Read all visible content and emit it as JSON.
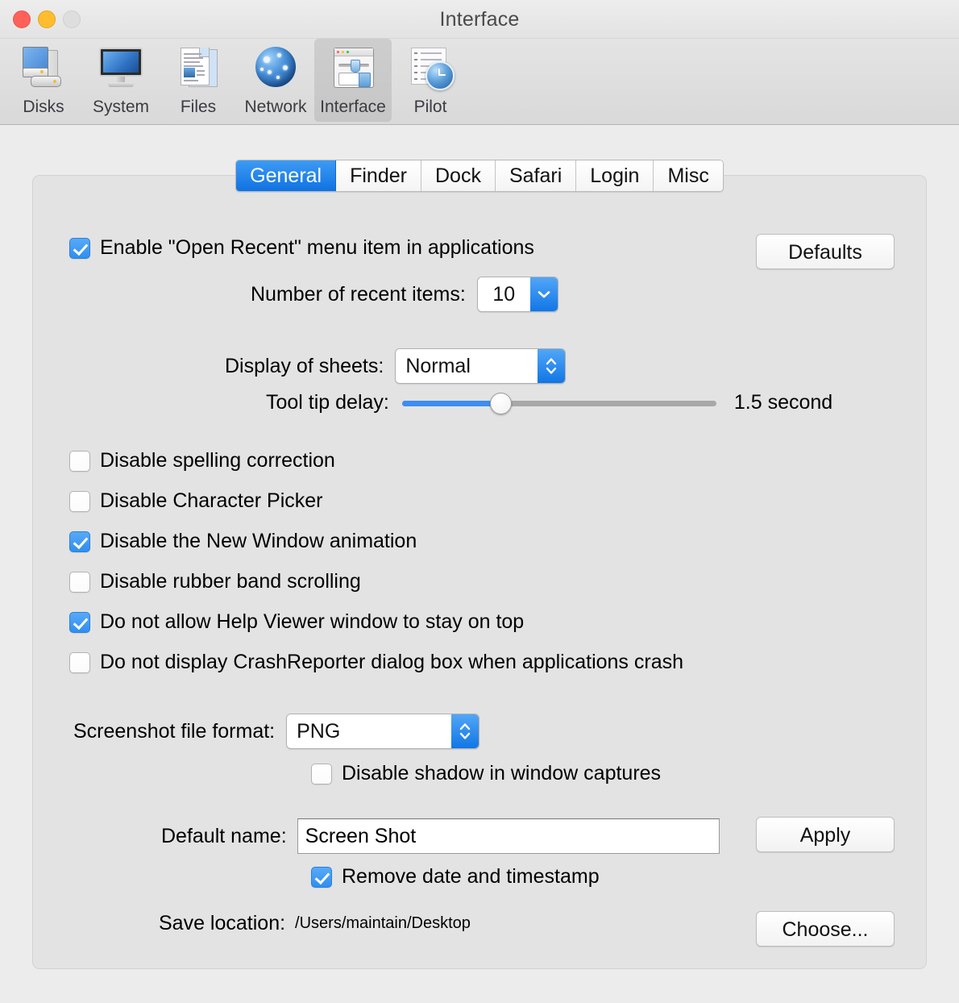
{
  "window": {
    "title": "Interface",
    "traffic_lights": [
      "close-button",
      "minimize-button",
      "zoom-button"
    ]
  },
  "toolbar": {
    "items": [
      {
        "label": "Disks",
        "icon": "disks-icon",
        "selected": false
      },
      {
        "label": "System",
        "icon": "system-icon",
        "selected": false
      },
      {
        "label": "Files",
        "icon": "files-icon",
        "selected": false
      },
      {
        "label": "Network",
        "icon": "network-icon",
        "selected": false
      },
      {
        "label": "Interface",
        "icon": "interface-icon",
        "selected": true
      },
      {
        "label": "Pilot",
        "icon": "pilot-icon",
        "selected": false
      }
    ]
  },
  "tabs": [
    {
      "label": "General",
      "active": true
    },
    {
      "label": "Finder",
      "active": false
    },
    {
      "label": "Dock",
      "active": false
    },
    {
      "label": "Safari",
      "active": false
    },
    {
      "label": "Login",
      "active": false
    },
    {
      "label": "Misc",
      "active": false
    }
  ],
  "general": {
    "open_recent": {
      "label": "Enable \"Open Recent\" menu item in applications",
      "checked": true
    },
    "defaults_button": "Defaults",
    "recent_items": {
      "label": "Number of recent items:",
      "value": "10"
    },
    "display_of_sheets": {
      "label": "Display of sheets:",
      "value": "Normal"
    },
    "tool_tip_delay": {
      "label": "Tool tip delay:",
      "value_text": "1.5 second",
      "percent": 31
    },
    "checkboxes": [
      {
        "label": "Disable spelling correction",
        "checked": false
      },
      {
        "label": "Disable Character Picker",
        "checked": false
      },
      {
        "label": "Disable the New Window animation",
        "checked": true
      },
      {
        "label": "Disable rubber band scrolling",
        "checked": false
      },
      {
        "label": "Do not allow Help Viewer window to stay on top",
        "checked": true
      },
      {
        "label": "Do not display CrashReporter dialog box when applications crash",
        "checked": false
      }
    ],
    "screenshot": {
      "format_label": "Screenshot file format:",
      "format_value": "PNG",
      "disable_shadow": {
        "label": "Disable shadow in window captures",
        "checked": false
      },
      "default_name_label": "Default name:",
      "default_name_value": "Screen Shot",
      "apply_button": "Apply",
      "remove_timestamp": {
        "label": "Remove date and timestamp",
        "checked": true
      },
      "save_location_label": "Save location:",
      "save_location_path": "/Users/maintain/Desktop",
      "choose_button": "Choose..."
    }
  },
  "colors": {
    "accent": "#2f8ef0",
    "window_bg": "#ececec",
    "groupbox_bg": "#e3e3e3",
    "close": "#ff6158",
    "minimize": "#ffbd2e",
    "zoom_disabled": "#dedede"
  }
}
